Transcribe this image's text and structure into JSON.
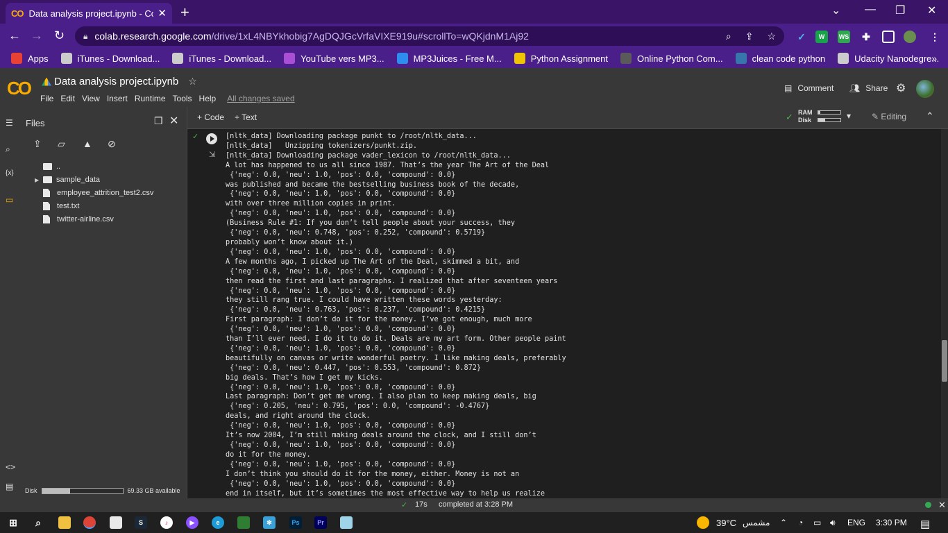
{
  "browser": {
    "tab_title": "Data analysis project.ipynb - Colab",
    "tab_logo": "CO",
    "url_domain": "colab.research.google.com",
    "url_path": "/drive/1xL4NBYkhobig7AgDQJGcVrfaVIXE919u#scrollTo=wQKjdnM1Aj92",
    "bookmarks": [
      {
        "label": "Apps",
        "icon": "apps-grid-icon",
        "color": "#e94235"
      },
      {
        "label": "iTunes - Download...",
        "icon": "apple-icon",
        "color": "#cccccc"
      },
      {
        "label": "iTunes - Download...",
        "icon": "globe-icon",
        "color": "#cccccc"
      },
      {
        "label": "YouTube vers MP3...",
        "icon": "youtube-mp3-icon",
        "color": "#a84fd6"
      },
      {
        "label": "MP3Juices - Free M...",
        "icon": "download-icon",
        "color": "#2d8ef0"
      },
      {
        "label": "Python Assignment",
        "icon": "python-assignment-icon",
        "color": "#f0c400"
      },
      {
        "label": "Online Python Com...",
        "icon": "bolt-icon",
        "color": "#5a5a5a"
      },
      {
        "label": "clean code python",
        "icon": "python-icon",
        "color": "#3776ab"
      },
      {
        "label": "Udacity Nanodegre...",
        "icon": "globe-icon",
        "color": "#cccccc"
      }
    ]
  },
  "colab": {
    "logo": "CO",
    "notebook_title": "Data analysis project.ipynb",
    "menus": [
      "File",
      "Edit",
      "View",
      "Insert",
      "Runtime",
      "Tools",
      "Help"
    ],
    "saved_status": "All changes saved",
    "comment_label": "Comment",
    "share_label": "Share",
    "add_code": "+ Code",
    "add_text": "+ Text",
    "ram_label": "RAM",
    "disk_label": "Disk",
    "ram_level": 0.1,
    "disk_level": 0.3,
    "editing_label": "Editing"
  },
  "sidebar": {
    "title": "Files",
    "files": [
      {
        "name": "..",
        "kind": "up"
      },
      {
        "name": "sample_data",
        "kind": "folder"
      },
      {
        "name": "employee_attrition_test2.csv",
        "kind": "file"
      },
      {
        "name": "test.txt",
        "kind": "file"
      },
      {
        "name": "twitter-airline.csv",
        "kind": "file"
      }
    ],
    "disk_label": "Disk",
    "disk_available": "69.33 GB available",
    "disk_used_fraction": 0.35
  },
  "output": {
    "exec_time_indicator": "✓",
    "lines": [
      "[nltk_data] Downloading package punkt to /root/nltk_data...",
      "[nltk_data]   Unzipping tokenizers/punkt.zip.",
      "[nltk_data] Downloading package vader_lexicon to /root/nltk_data...",
      "A lot has happened to us all since 1987. That’s the year The Art of the Deal",
      " {'neg': 0.0, 'neu': 1.0, 'pos': 0.0, 'compound': 0.0}",
      "was published and became the bestselling business book of the decade,",
      " {'neg': 0.0, 'neu': 1.0, 'pos': 0.0, 'compound': 0.0}",
      "with over three million copies in print.",
      " {'neg': 0.0, 'neu': 1.0, 'pos': 0.0, 'compound': 0.0}",
      "(Business Rule #1: If you don’t tell people about your success, they",
      " {'neg': 0.0, 'neu': 0.748, 'pos': 0.252, 'compound': 0.5719}",
      "probably won’t know about it.)",
      " {'neg': 0.0, 'neu': 1.0, 'pos': 0.0, 'compound': 0.0}",
      "A few months ago, I picked up The Art of the Deal, skimmed a bit, and",
      " {'neg': 0.0, 'neu': 1.0, 'pos': 0.0, 'compound': 0.0}",
      "then read the first and last paragraphs. I realized that after seventeen years",
      " {'neg': 0.0, 'neu': 1.0, 'pos': 0.0, 'compound': 0.0}",
      "they still rang true. I could have written these words yesterday:",
      " {'neg': 0.0, 'neu': 0.763, 'pos': 0.237, 'compound': 0.4215}",
      "First paragraph: I don’t do it for the money. I’ve got enough, much more",
      " {'neg': 0.0, 'neu': 1.0, 'pos': 0.0, 'compound': 0.0}",
      "than I’ll ever need. I do it to do it. Deals are my art form. Other people paint",
      " {'neg': 0.0, 'neu': 1.0, 'pos': 0.0, 'compound': 0.0}",
      "beautifully on canvas or write wonderful poetry. I like making deals, preferably",
      " {'neg': 0.0, 'neu': 0.447, 'pos': 0.553, 'compound': 0.872}",
      "big deals. That’s how I get my kicks.",
      " {'neg': 0.0, 'neu': 1.0, 'pos': 0.0, 'compound': 0.0}",
      "Last paragraph: Don’t get me wrong. I also plan to keep making deals, big",
      " {'neg': 0.205, 'neu': 0.795, 'pos': 0.0, 'compound': -0.4767}",
      "deals, and right around the clock.",
      " {'neg': 0.0, 'neu': 1.0, 'pos': 0.0, 'compound': 0.0}",
      "It’s now 2004, I’m still making deals around the clock, and I still don’t",
      " {'neg': 0.0, 'neu': 1.0, 'pos': 0.0, 'compound': 0.0}",
      "do it for the money.",
      " {'neg': 0.0, 'neu': 1.0, 'pos': 0.0, 'compound': 0.0}",
      "I don’t think you should do it for the money, either. Money is not an",
      " {'neg': 0.0, 'neu': 1.0, 'pos': 0.0, 'compound': 0.0}",
      "end in itself, but it’s sometimes the most effective way to help us realize"
    ]
  },
  "statusbar": {
    "check": "✓",
    "duration": "17s",
    "completed": "completed at 3:28 PM"
  },
  "taskbar": {
    "weather_temp": "39°C",
    "weather_text": "مشمس",
    "language": "ENG",
    "time": "3:30 PM"
  }
}
